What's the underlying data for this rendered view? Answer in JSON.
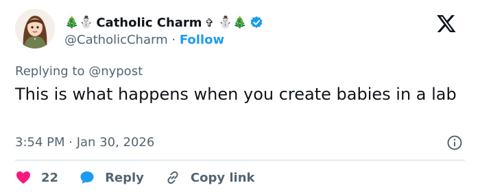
{
  "author": {
    "display_name": "Catholic Charm",
    "name_emoji_left": "🎄⛄",
    "cross_symbol": "✞",
    "name_emoji_right": "⛄🎄",
    "handle": "@CatholicCharm",
    "separator": "·",
    "follow_label": "Follow",
    "verified": true
  },
  "tweet": {
    "replying_to": "Replying to @nypost",
    "text": "This is what happens when you create babies in a lab",
    "timestamp": "3:54 PM · Jan 30, 2026"
  },
  "actions": {
    "like_count": "22",
    "reply_label": "Reply",
    "copy_link_label": "Copy link"
  },
  "colors": {
    "link_blue": "#1d9bf0",
    "like_pink": "#f91880",
    "secondary_text": "#536471",
    "primary_text": "#0f1419"
  },
  "icons": {
    "brand": "x-logo-icon",
    "verified": "verified-badge-icon",
    "info": "info-icon",
    "like": "heart-icon",
    "reply": "speech-bubble-icon",
    "copy": "link-icon"
  }
}
